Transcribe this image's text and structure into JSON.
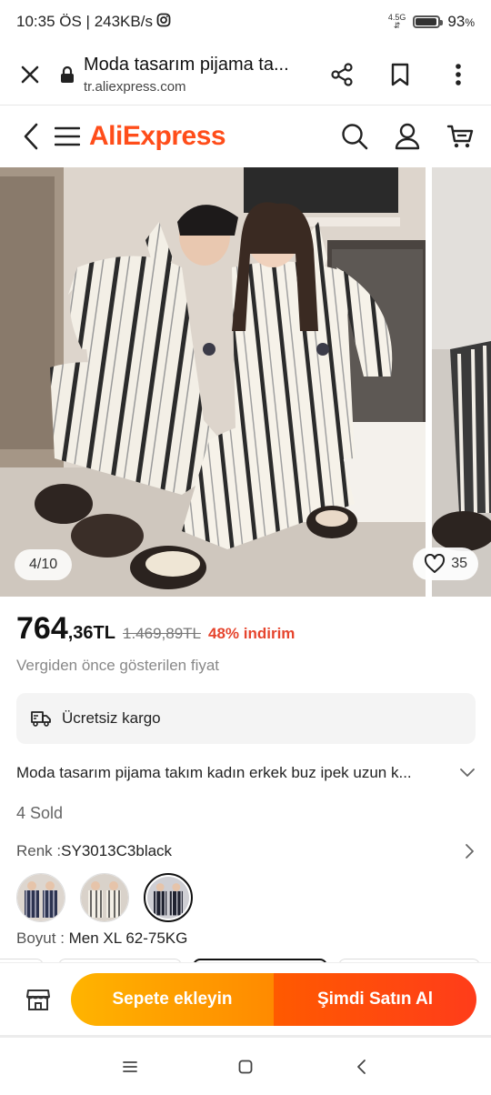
{
  "status_bar": {
    "time_info": "10:35 ÖS | 243KB/s",
    "instagram_icon": "instagram-icon",
    "network": "4.5G",
    "battery_pct": "93",
    "battery_unit": "%",
    "battery_level": 0.93
  },
  "browser": {
    "title": "Moda tasarım pijama ta...",
    "url": "tr.aliexpress.com",
    "icons": [
      "close-icon",
      "lock-icon",
      "share-icon",
      "bookmark-icon",
      "more-icon"
    ]
  },
  "header": {
    "logo": "AliExpress",
    "icons": [
      "back-icon",
      "menu-icon",
      "search-icon",
      "account-icon",
      "cart-icon"
    ]
  },
  "gallery": {
    "counter": "4/10",
    "wishlist_count": "35"
  },
  "price": {
    "integer": "764",
    "decimal": ",36",
    "currency": "TL",
    "original": "1.469,89TL",
    "discount": "48% indirim",
    "tax_note": "Vergiden önce gösterilen fiyat"
  },
  "shipping": {
    "label": "Ücretsiz kargo"
  },
  "product": {
    "title": "Moda tasarım pijama takım kadın erkek buz ipek uzun k...",
    "sold": "4 Sold"
  },
  "color": {
    "label": "Renk : ",
    "value": "SY3013C3black",
    "selected_index": 2,
    "swatch_count": 3
  },
  "size": {
    "label": "Boyut : ",
    "value": "Men XL 62-75KG"
  },
  "actions": {
    "add_to_cart": "Sepete ekleyin",
    "buy_now": "Şimdi Satın Al"
  },
  "colors": {
    "brand": "#ff4d1a",
    "discount": "#e6452e",
    "cart_start": "#ffb400",
    "cart_end": "#ff8a00",
    "buy_start": "#ff5a00",
    "buy_end": "#ff3c1a"
  }
}
